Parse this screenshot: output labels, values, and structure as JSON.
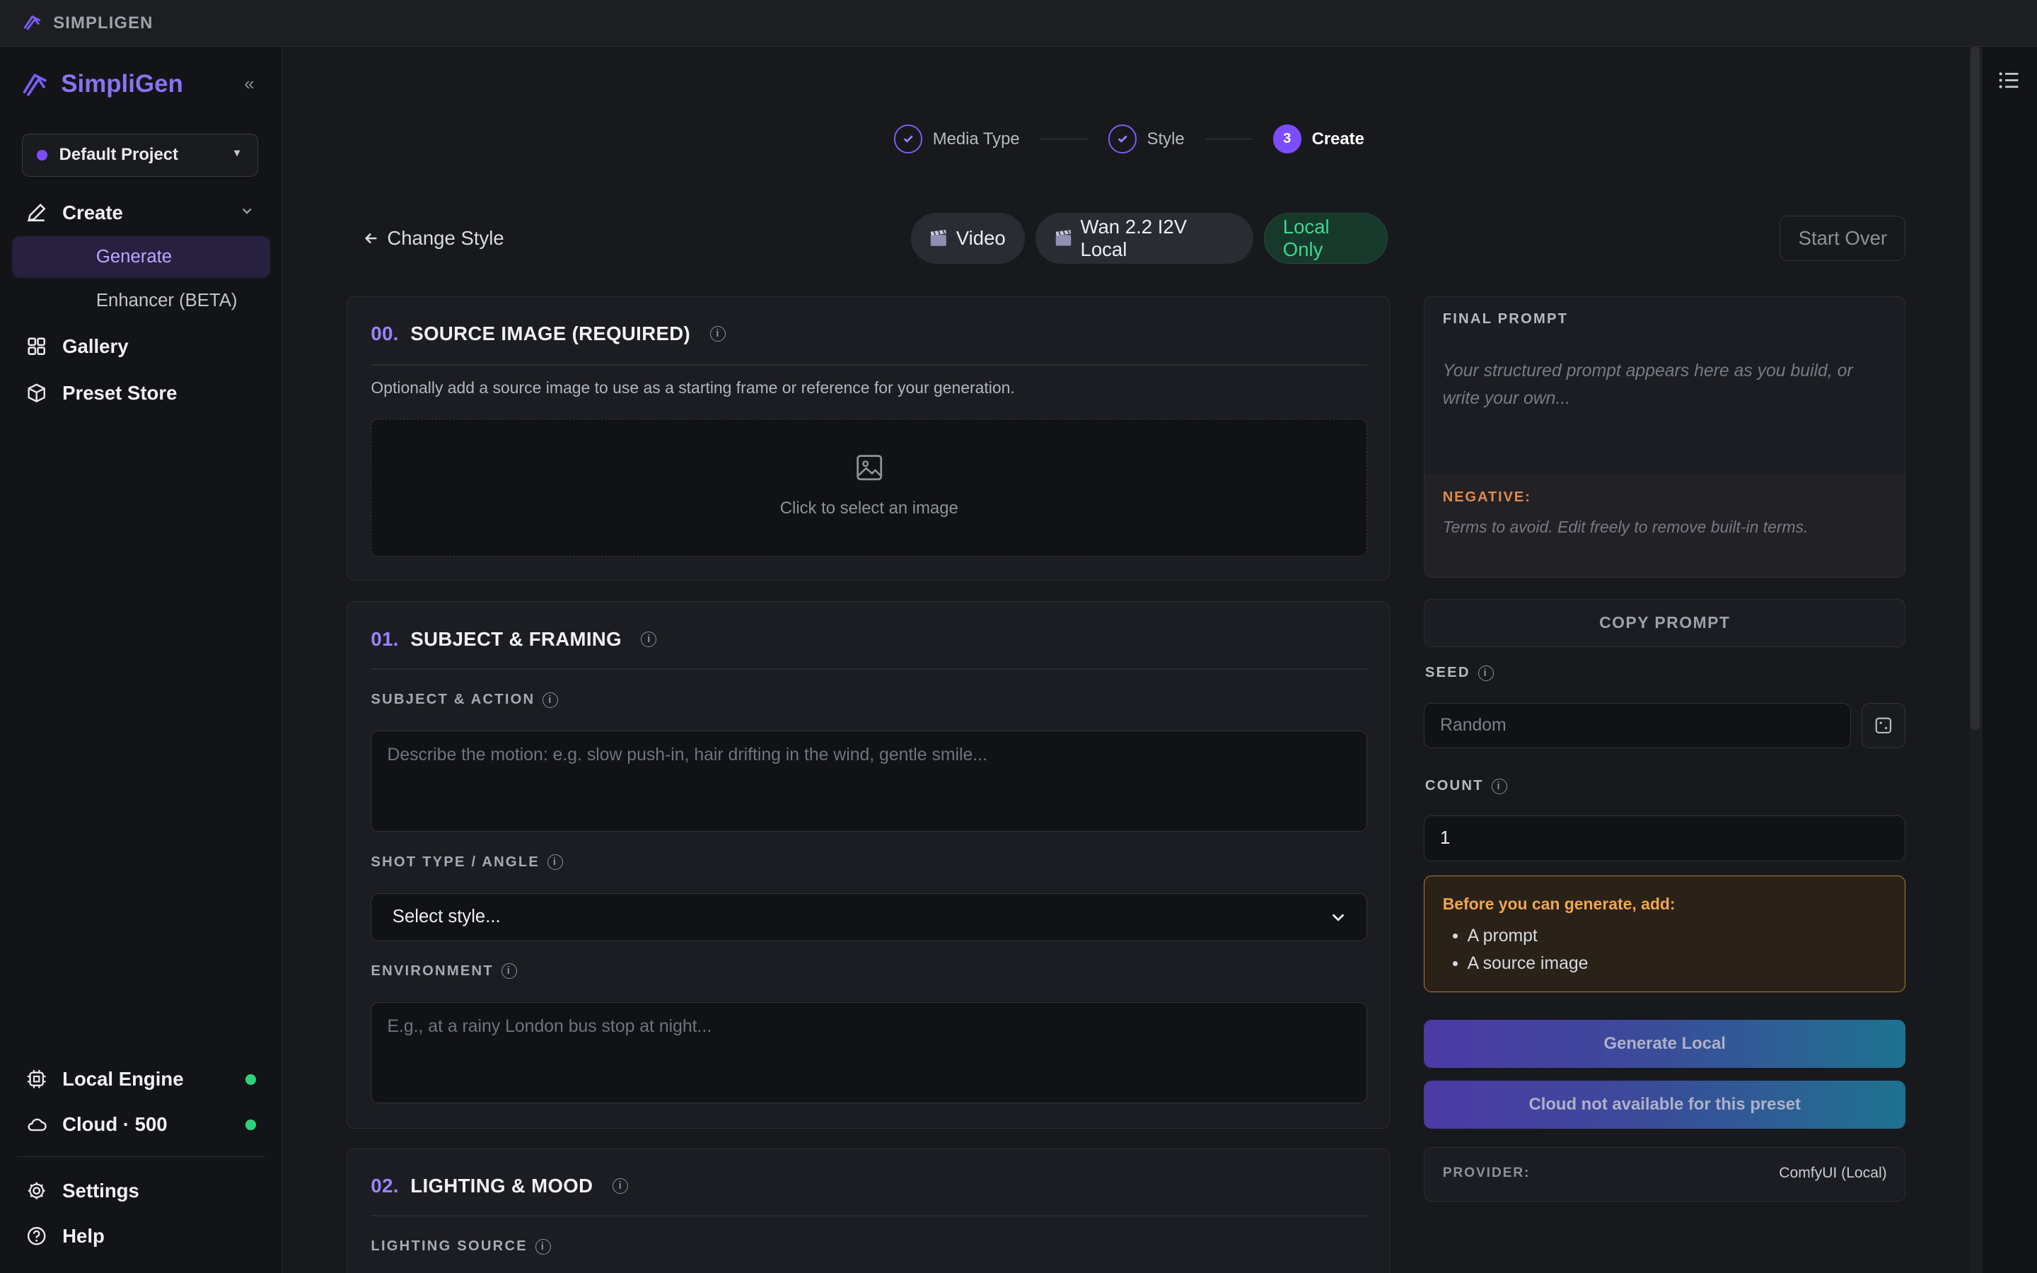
{
  "window": {
    "title": "SIMPLIGEN"
  },
  "sidebar": {
    "brand": "SimpliGen",
    "collapse_glyph": "«",
    "project": "Default Project",
    "nav": {
      "create": "Create",
      "generate": "Generate",
      "enhancer": "Enhancer (BETA)",
      "gallery": "Gallery",
      "preset_store": "Preset Store",
      "local_engine": "Local Engine",
      "cloud": "Cloud · 500",
      "settings": "Settings",
      "help": "Help"
    }
  },
  "stepper": {
    "steps": [
      {
        "label": "Media Type",
        "state": "done"
      },
      {
        "label": "Style",
        "state": "done"
      },
      {
        "number": "3",
        "label": "Create",
        "state": "active"
      }
    ]
  },
  "toolbar": {
    "back_label": "Change Style",
    "chip_media": "Video",
    "chip_model": "Wan 2.2 I2V Local",
    "chip_mode": "Local Only",
    "start_over": "Start Over"
  },
  "sections": {
    "source": {
      "index": "00.",
      "title": "SOURCE IMAGE (REQUIRED)",
      "description": "Optionally add a source image to use as a starting frame or reference for your generation.",
      "dropzone_label": "Click to select an image"
    },
    "subject": {
      "index": "01.",
      "title": "SUBJECT & FRAMING",
      "subject_label": "SUBJECT & ACTION",
      "subject_placeholder": "Describe the motion: e.g. slow push-in, hair drifting in the wind, gentle smile...",
      "shot_label": "SHOT TYPE / ANGLE",
      "shot_value": "Select style...",
      "environment_label": "ENVIRONMENT",
      "environment_placeholder": "E.g., at a rainy London bus stop at night..."
    },
    "lighting": {
      "index": "02.",
      "title": "LIGHTING & MOOD",
      "source_label": "LIGHTING SOURCE"
    }
  },
  "panel": {
    "final_prompt_label": "FINAL PROMPT",
    "final_prompt_placeholder": "Your structured prompt appears here as you build, or write your own...",
    "negative_label": "NEGATIVE:",
    "negative_placeholder": "Terms to avoid. Edit freely to remove built-in terms.",
    "copy_button": "COPY PROMPT",
    "seed_label": "SEED",
    "seed_placeholder": "Random",
    "count_label": "COUNT",
    "count_value": "1",
    "warning_title": "Before you can generate, add:",
    "warning_items": [
      "A prompt",
      "A source image"
    ],
    "generate_local": "Generate Local",
    "generate_cloud": "Cloud not available for this preset",
    "provider_label": "PROVIDER:",
    "provider_value": "ComfyUI (Local)"
  },
  "colors": {
    "accent": "#7c4dff",
    "success": "#2fd27a",
    "warning": "#f2a64a",
    "negative": "#e08a4a"
  }
}
